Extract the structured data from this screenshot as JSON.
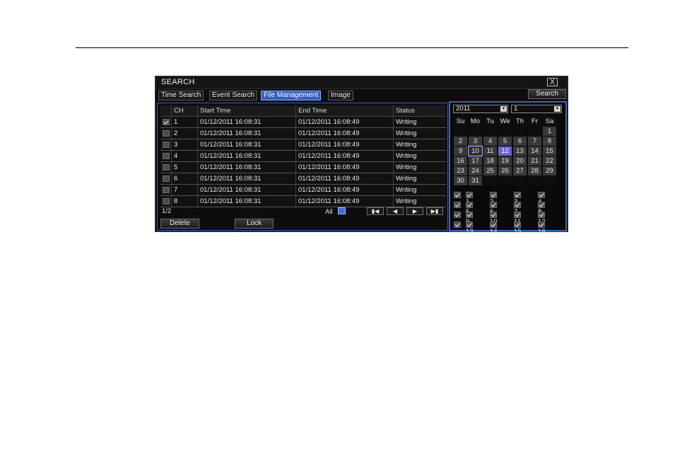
{
  "window": {
    "title": "SEARCH",
    "close_label": "X"
  },
  "tabs": [
    {
      "label": "Time Search",
      "active": false
    },
    {
      "label": "Event Search",
      "active": false
    },
    {
      "label": "File Management",
      "active": true
    },
    {
      "label": "Image",
      "active": false
    }
  ],
  "search_button": "Search",
  "table": {
    "headers": [
      "CH",
      "Start Time",
      "End Time",
      "Status"
    ],
    "rows": [
      {
        "checked": true,
        "ch": "1",
        "start": "01/12/2011 16:08:31",
        "end": "01/12/2011 16:08:49",
        "status": "Writing"
      },
      {
        "checked": false,
        "ch": "2",
        "start": "01/12/2011 16:08:31",
        "end": "01/12/2011 16:08:49",
        "status": "Writing"
      },
      {
        "checked": false,
        "ch": "3",
        "start": "01/12/2011 16:08:31",
        "end": "01/12/2011 16:08:49",
        "status": "Writing"
      },
      {
        "checked": false,
        "ch": "4",
        "start": "01/12/2011 16:08:31",
        "end": "01/12/2011 16:08:49",
        "status": "Writing"
      },
      {
        "checked": false,
        "ch": "5",
        "start": "01/12/2011 16:08:31",
        "end": "01/12/2011 16:08:49",
        "status": "Writing"
      },
      {
        "checked": false,
        "ch": "6",
        "start": "01/12/2011 16:08:31",
        "end": "01/12/2011 16:08:49",
        "status": "Writing"
      },
      {
        "checked": false,
        "ch": "7",
        "start": "01/12/2011 16:08:31",
        "end": "01/12/2011 16:08:49",
        "status": "Writing"
      },
      {
        "checked": false,
        "ch": "8",
        "start": "01/12/2011 16:08:31",
        "end": "01/12/2011 16:08:49",
        "status": "Writing"
      }
    ]
  },
  "pager": {
    "page": "1/2",
    "all_label": "All"
  },
  "nav_icons": [
    "first-page-icon",
    "prev-page-icon",
    "next-page-icon",
    "last-page-icon"
  ],
  "buttons": {
    "delete": "Delete",
    "lock": "Lock"
  },
  "calendar": {
    "year": "2011",
    "month": "1",
    "weekdays": [
      "Su",
      "Mo",
      "Tu",
      "We",
      "Th",
      "Fr",
      "Sa"
    ],
    "first_weekday_index": 6,
    "days_in_month": 31,
    "highlighted_days": [
      10,
      12
    ],
    "selected_day": 12
  },
  "channels": [
    "1",
    "2",
    "3",
    "4",
    "5",
    "6",
    "7",
    "8",
    "9",
    "10",
    "11",
    "12",
    "13",
    "14",
    "15",
    "16"
  ],
  "colors": {
    "accent": "#2f5fc4",
    "selected_day": "#6b62e0",
    "window_bg": "#0d0d0d"
  }
}
